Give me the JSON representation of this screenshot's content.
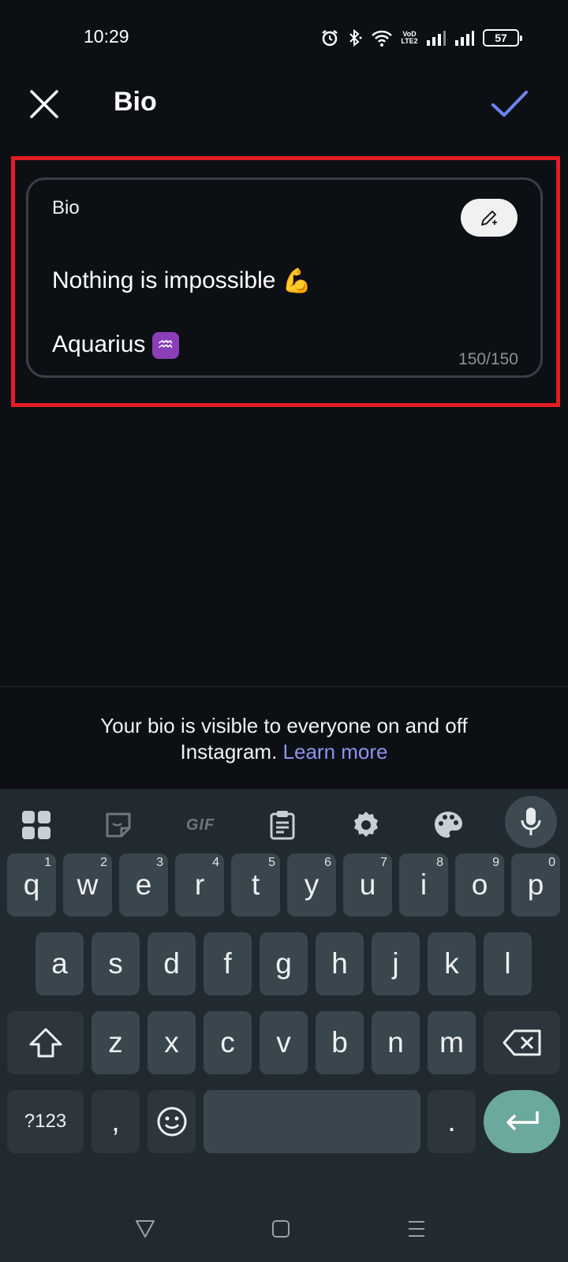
{
  "status_bar": {
    "time": "10:29",
    "volte_top": "VoD",
    "volte_bottom": "LTE2",
    "battery": "57"
  },
  "header": {
    "title": "Bio"
  },
  "bio_field": {
    "label": "Bio",
    "line1": "Nothing is impossible",
    "line1_emoji": "💪",
    "line2": "Aquarius",
    "line2_emoji": "♒",
    "char_count": "150/150"
  },
  "footer": {
    "note_line1": "Your bio is visible to everyone on and off",
    "note_line2_prefix": "Instagram.",
    "learn_more": "Learn more"
  },
  "keyboard": {
    "toolbar": {
      "gif_label": "GIF"
    },
    "row1": [
      {
        "label": "q",
        "hint": "1"
      },
      {
        "label": "w",
        "hint": "2"
      },
      {
        "label": "e",
        "hint": "3"
      },
      {
        "label": "r",
        "hint": "4"
      },
      {
        "label": "t",
        "hint": "5"
      },
      {
        "label": "y",
        "hint": "6"
      },
      {
        "label": "u",
        "hint": "7"
      },
      {
        "label": "i",
        "hint": "8"
      },
      {
        "label": "o",
        "hint": "9"
      },
      {
        "label": "p",
        "hint": "0"
      }
    ],
    "row2": [
      "a",
      "s",
      "d",
      "f",
      "g",
      "h",
      "j",
      "k",
      "l"
    ],
    "row3": [
      "z",
      "x",
      "c",
      "v",
      "b",
      "n",
      "m"
    ],
    "symbols_label": "?123",
    "comma": ",",
    "period": "."
  },
  "colors": {
    "accent": "#6f86f0",
    "highlight_border": "#e31d24",
    "link": "#8c94ec",
    "enter_key": "#6ba89d"
  }
}
